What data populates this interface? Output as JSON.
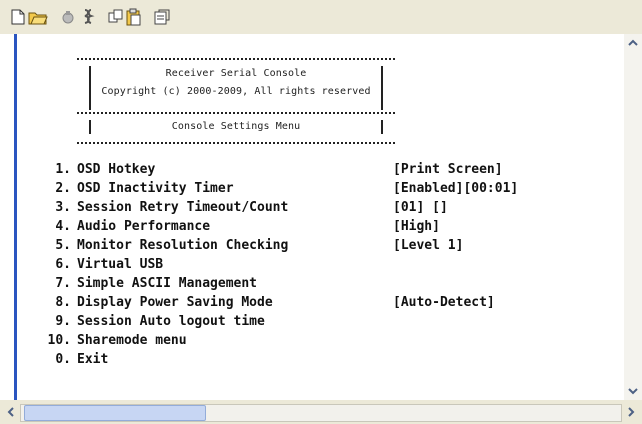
{
  "toolbar": {
    "buttons": [
      {
        "name": "new-file-icon"
      },
      {
        "name": "open-folder-icon"
      },
      {
        "name": "connect-icon"
      },
      {
        "name": "disconnect-icon"
      },
      {
        "name": "copy-icon"
      },
      {
        "name": "paste-icon"
      },
      {
        "name": "properties-icon"
      }
    ]
  },
  "header": {
    "title": "Receiver Serial Console",
    "copyright": "Copyright (c) 2000-2009, All rights reserved",
    "menu_title": "Console Settings Menu"
  },
  "menu": [
    {
      "num": "1.",
      "label": "OSD Hotkey",
      "value": "[Print Screen]"
    },
    {
      "num": "2.",
      "label": "OSD Inactivity Timer",
      "value": "[Enabled][00:01]"
    },
    {
      "num": "3.",
      "label": "Session Retry Timeout/Count",
      "value": "[01] []"
    },
    {
      "num": "4.",
      "label": "Audio Performance",
      "value": "[High]"
    },
    {
      "num": "5.",
      "label": "Monitor Resolution Checking",
      "value": "[Level 1]"
    },
    {
      "num": "6.",
      "label": "Virtual USB",
      "value": ""
    },
    {
      "num": "7.",
      "label": "Simple ASCII Management",
      "value": ""
    },
    {
      "num": "8.",
      "label": "Display Power Saving Mode",
      "value": "[Auto-Detect]"
    },
    {
      "num": "9.",
      "label": "Session Auto logout time",
      "value": ""
    },
    {
      "num": "10.",
      "label": "Sharemode menu",
      "value": ""
    },
    {
      "num": "0.",
      "label": "Exit",
      "value": ""
    }
  ]
}
